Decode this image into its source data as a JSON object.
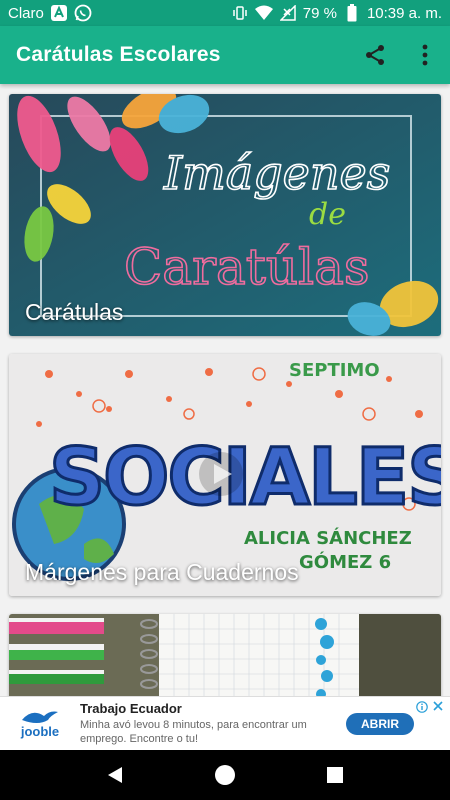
{
  "status_bar": {
    "carrier": "Claro",
    "battery": "79 %",
    "time": "10:39 a. m."
  },
  "app_bar": {
    "title": "Carátulas Escolares"
  },
  "cards": [
    {
      "caption": "Carátulas",
      "art_text_1": "Imágenes",
      "art_text_2": "de",
      "art_text_3": "Caratúlas"
    },
    {
      "caption": "Márgenes para Cuadernos",
      "art_text_1": "SOCIALES",
      "art_text_2": "ALICIA SÁNCHEZ",
      "art_text_3": "GÓMEZ 6",
      "art_text_4": "SEPTIMO"
    },
    {
      "caption": ""
    }
  ],
  "ad": {
    "brand": "jooble",
    "title": "Trabajo Ecuador",
    "body": "Minha avó levou 8 minutos, para encontrar um emprego. Encontre o tu!",
    "cta": "ABRIR"
  },
  "colors": {
    "status_bar": "#12a07d",
    "app_bar": "#19b18b",
    "cta": "#1f6fb8"
  }
}
